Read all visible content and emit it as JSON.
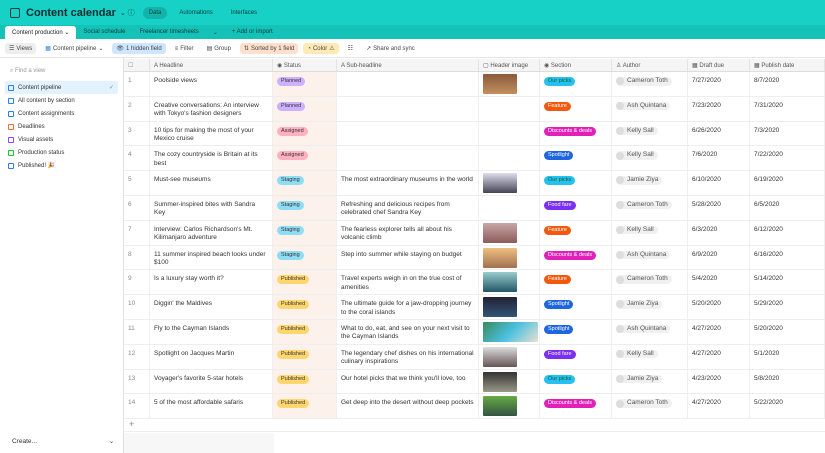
{
  "app": {
    "title": "Content calendar",
    "top_tabs": [
      "Data",
      "Automations",
      "Interfaces"
    ]
  },
  "tables": [
    "Content production",
    "Social schedule",
    "Freelancer timesheets"
  ],
  "add_import": "+ Add or import",
  "toolbar": {
    "views": "Views",
    "view_name": "Content pipeline",
    "hidden": "1 hidden field",
    "filter": "Filter",
    "group": "Group",
    "sorted": "Sorted by 1 field",
    "color": "Color",
    "share": "Share and sync"
  },
  "sidebar": {
    "find": "Find a view",
    "views": [
      {
        "label": "Content pipeline",
        "color": "#2d7ff9"
      },
      {
        "label": "All content by section",
        "color": "#2d7ff9"
      },
      {
        "label": "Content assignments",
        "color": "#2d7ff9"
      },
      {
        "label": "Deadlines",
        "color": "#f26b3a"
      },
      {
        "label": "Visual assets",
        "color": "#8b46ff"
      },
      {
        "label": "Production status",
        "color": "#20c933"
      },
      {
        "label": "Published! 🎉",
        "color": "#2d7ff9"
      }
    ],
    "create": "Create..."
  },
  "columns": [
    "Headline",
    "Status",
    "Sub-headline",
    "Header image",
    "Section",
    "Author",
    "Draft due",
    "Publish date"
  ],
  "status_colors": {
    "Planned": "#cdb0ff",
    "Assigned": "#ffb0c0",
    "Staging": "#8fdcf5",
    "Published": "#ffd66e"
  },
  "section_colors": {
    "Our picks": "#27c0f0",
    "Feature": "#f2590e",
    "Discounts & deals": "#e020b8",
    "Spotlight": "#1e66e0",
    "Food fare": "#7b2ff0"
  },
  "rows": [
    {
      "n": "1",
      "headline": "Poolside views",
      "status": "Planned",
      "sub": "",
      "img": "linear-gradient(#8a5a3a,#c49060)",
      "section": "Our picks",
      "author": "Cameron Toth",
      "draft": "7/27/2020",
      "publish": "8/7/2020"
    },
    {
      "n": "2",
      "headline": "Creative conversations: An interview with Tokyo's fashion designers",
      "status": "Planned",
      "sub": "",
      "img": "",
      "section": "Feature",
      "author": "Ash Quintana",
      "draft": "7/23/2020",
      "publish": "7/31/2020"
    },
    {
      "n": "3",
      "headline": "10 tips for making the most of your Mexico cruise",
      "status": "Assigned",
      "sub": "",
      "img": "",
      "section": "Discounts & deals",
      "author": "Kelly Sall",
      "draft": "6/26/2020",
      "publish": "7/3/2020"
    },
    {
      "n": "4",
      "headline": "The cozy countryside is Britain at its best",
      "status": "Assigned",
      "sub": "",
      "img": "",
      "section": "Spotlight",
      "author": "Kelly Sall",
      "draft": "7/6/2020",
      "publish": "7/22/2020"
    },
    {
      "n": "5",
      "headline": "Must-see museums",
      "status": "Staging",
      "sub": "The most extraordinary museums in the world",
      "img": "linear-gradient(#dde,#445)",
      "section": "Our picks",
      "author": "Jamie Ziya",
      "draft": "6/10/2020",
      "publish": "6/19/2020"
    },
    {
      "n": "6",
      "headline": "Summer-inspired bites with Sandra Key",
      "status": "Staging",
      "sub": "Refreshing and delicious recipes from celebrated chef Sandra Key",
      "img": "",
      "section": "Food fare",
      "author": "Cameron Toth",
      "draft": "5/28/2020",
      "publish": "6/5/2020"
    },
    {
      "n": "7",
      "headline": "Interview: Carlos Richardson's Mt. Kilimanjaro adventure",
      "status": "Staging",
      "sub": "The fearless explorer tells all about his volcanic climb",
      "img": "linear-gradient(#c9a7a4,#8a5a5a)",
      "section": "Feature",
      "author": "Kelly Sall",
      "draft": "6/3/2020",
      "publish": "6/12/2020"
    },
    {
      "n": "8",
      "headline": "11 summer inspired beach looks under $100",
      "status": "Staging",
      "sub": "Step into summer while staying on budget",
      "img": "linear-gradient(#f0c080,#a07050)",
      "section": "Discounts & deals",
      "author": "Ash Quintana",
      "draft": "6/9/2020",
      "publish": "6/16/2020"
    },
    {
      "n": "9",
      "headline": "Is a luxury stay worth it?",
      "status": "Published",
      "sub": "Travel experts weigh in on the true cost of amenities",
      "img": "linear-gradient(#9cc,#256)",
      "section": "Feature",
      "author": "Cameron Toth",
      "draft": "5/4/2020",
      "publish": "5/14/2020"
    },
    {
      "n": "10",
      "headline": "Diggin' the Maldives",
      "status": "Published",
      "sub": "The ultimate guide for a jaw-dropping journey to the coral islands",
      "img": "linear-gradient(#223,#357)",
      "section": "Spotlight",
      "author": "Jamie Ziya",
      "draft": "5/20/2020",
      "publish": "5/29/2020"
    },
    {
      "n": "11",
      "headline": "Fly to the Cayman Islands",
      "status": "Published",
      "sub": "What to do, eat, and see on your next visit to the Cayman Islands",
      "img": "linear-gradient(135deg,#3a8a5a,#4ac0e0,#e8e0d0)",
      "section": "Spotlight",
      "author": "Ash Quintana",
      "draft": "4/27/2020",
      "publish": "5/20/2020"
    },
    {
      "n": "12",
      "headline": "Spotlight on Jacques Martin",
      "status": "Published",
      "sub": "The legendary chef dishes on his international culinary inspirations",
      "img": "linear-gradient(#ddd,#655)",
      "section": "Food fare",
      "author": "Kelly Sall",
      "draft": "4/27/2020",
      "publish": "5/1/2020"
    },
    {
      "n": "13",
      "headline": "Voyager's favorite 5-star hotels",
      "status": "Published",
      "sub": "Our hotel picks that we think you'll love, too",
      "img": "linear-gradient(#333,#998)",
      "section": "Our picks",
      "author": "Jamie Ziya",
      "draft": "4/23/2020",
      "publish": "5/8/2020"
    },
    {
      "n": "14",
      "headline": "5 of the most affordable safaris",
      "status": "Published",
      "sub": "Get deep into the desert without deep pockets",
      "img": "linear-gradient(#6a4,#354)",
      "section": "Discounts & deals",
      "author": "Cameron Toth",
      "draft": "4/27/2020",
      "publish": "5/22/2020"
    }
  ]
}
